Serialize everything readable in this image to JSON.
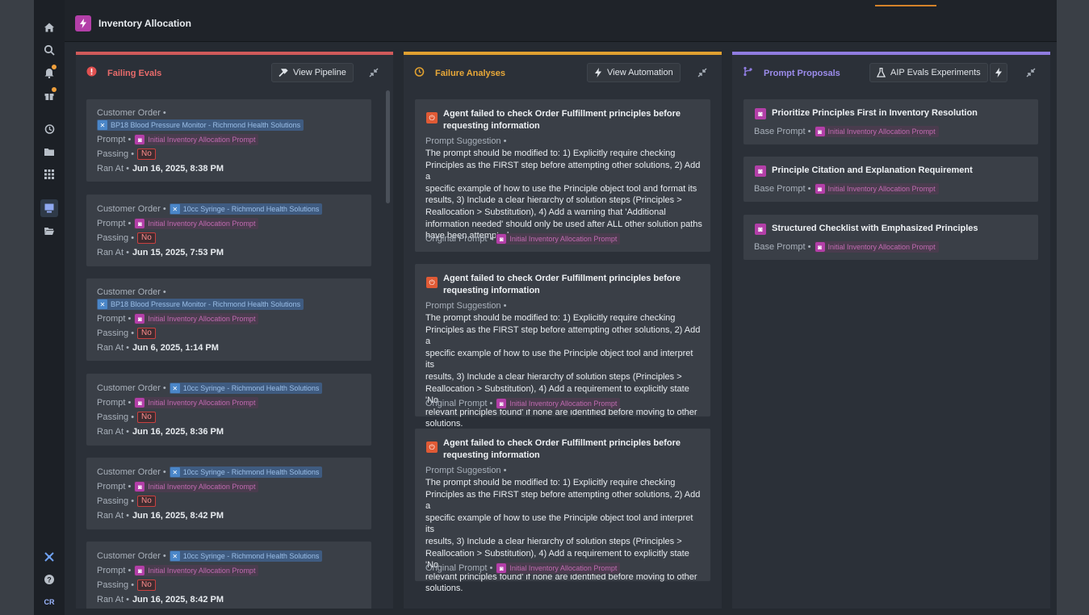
{
  "app": {
    "title": "Inventory Allocation"
  },
  "sidebar": {
    "avatar": "CR"
  },
  "columns": {
    "failing": {
      "title": "Failing Evals",
      "button": "View Pipeline",
      "accent": "#e05050",
      "labels": {
        "order": "Customer Order •",
        "prompt": "Prompt •",
        "passing": "Passing •",
        "ran": "Ran At •"
      },
      "items": [
        {
          "order": "BP18 Blood Pressure Monitor - Richmond Health Solutions",
          "prompt": "Initial Inventory Allocation Prompt",
          "passing": "No",
          "ran": "Jun 16, 2025, 8:38 PM"
        },
        {
          "order": "10cc Syringe - Richmond Health Solutions",
          "prompt": "Initial Inventory Allocation Prompt",
          "passing": "No",
          "ran": "Jun 15, 2025, 7:53 PM"
        },
        {
          "order": "BP18 Blood Pressure Monitor - Richmond Health Solutions",
          "prompt": "Initial Inventory Allocation Prompt",
          "passing": "No",
          "ran": "Jun 6, 2025, 1:14 PM"
        },
        {
          "order": "10cc Syringe - Richmond Health Solutions",
          "prompt": "Initial Inventory Allocation Prompt",
          "passing": "No",
          "ran": "Jun 16, 2025, 8:36 PM"
        },
        {
          "order": "10cc Syringe - Richmond Health Solutions",
          "prompt": "Initial Inventory Allocation Prompt",
          "passing": "No",
          "ran": "Jun 16, 2025, 8:42 PM"
        },
        {
          "order": "10cc Syringe - Richmond Health Solutions",
          "prompt": "Initial Inventory Allocation Prompt",
          "passing": "No",
          "ran": "Jun 16, 2025, 8:42 PM"
        }
      ]
    },
    "analyses": {
      "title": "Failure Analyses",
      "button": "View Automation",
      "accent": "#e0a030",
      "labels": {
        "suggestion": "Prompt Suggestion •",
        "original": "Original Prompt •"
      },
      "items": [
        {
          "title": "Agent failed to check Order Fulfillment principles before requesting information",
          "suggestion_lines": [
            "The prompt should be modified to: 1) Explicitly require checking",
            "Principles as the FIRST step before attempting other solutions, 2) Add a",
            "specific example of how to use the Principle object tool and format its",
            "results, 3) Include a clear hierarchy of solution steps (Principles >",
            "Reallocation > Substitution), 4) Add a warning that 'Additional",
            "information needed' should only be used after ALL other solution paths",
            "have been attempted."
          ],
          "original": "Initial Inventory Allocation Prompt"
        },
        {
          "title": "Agent failed to check Order Fulfillment principles before requesting information",
          "suggestion_lines": [
            "The prompt should be modified to: 1) Explicitly require checking",
            "Principles as the FIRST step before attempting other solutions, 2) Add a",
            "specific example of how to use the Principle object tool and interpret its",
            "results, 3) Include a clear hierarchy of solution steps (Principles >",
            "Reallocation > Substitution), 4) Add a requirement to explicitly state 'No",
            "relevant principles found' if none are identified before moving to other",
            "solutions."
          ],
          "original": "Initial Inventory Allocation Prompt"
        },
        {
          "title": "Agent failed to check Order Fulfillment principles before requesting information",
          "suggestion_lines": [
            "The prompt should be modified to: 1) Explicitly require checking",
            "Principles as the FIRST step before attempting other solutions, 2) Add a",
            "specific example of how to use the Principle object tool and interpret its",
            "results, 3) Include a clear hierarchy of solution steps (Principles >",
            "Reallocation > Substitution), 4) Add a requirement to explicitly state 'No",
            "relevant principles found' if none are identified before moving to other",
            "solutions."
          ],
          "original": "Initial Inventory Allocation Prompt"
        }
      ]
    },
    "proposals": {
      "title": "Prompt Proposals",
      "button": "AIP Evals Experiments",
      "accent": "#8f7ce0",
      "labels": {
        "base": "Base Prompt •"
      },
      "items": [
        {
          "title": "Prioritize Principles First in Inventory Resolution",
          "base": "Initial Inventory Allocation Prompt"
        },
        {
          "title": "Principle Citation and Explanation Requirement",
          "base": "Initial Inventory Allocation Prompt"
        },
        {
          "title": "Structured Checklist with Emphasized Principles",
          "base": "Initial Inventory Allocation Prompt"
        }
      ]
    }
  }
}
